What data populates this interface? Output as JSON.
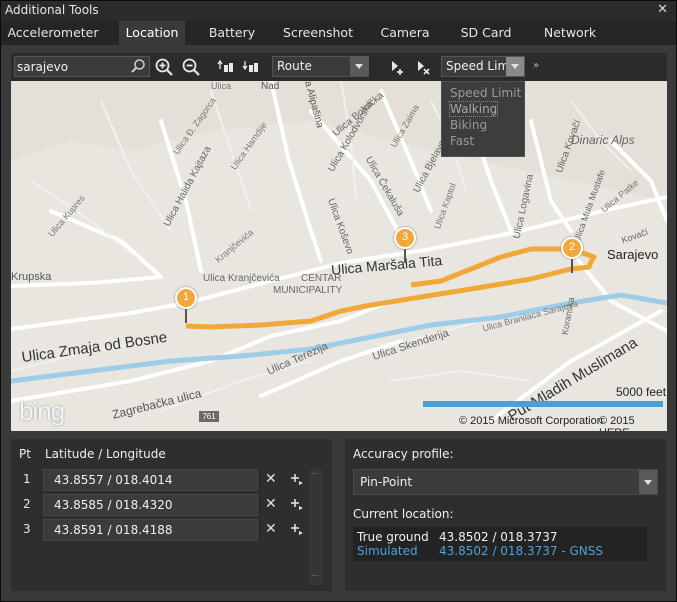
{
  "window": {
    "title": "Additional Tools",
    "close_glyph": "✕"
  },
  "tabs": [
    {
      "label": "Accelerometer"
    },
    {
      "label": "Location",
      "active": true
    },
    {
      "label": "Battery"
    },
    {
      "label": "Screenshot"
    },
    {
      "label": "Camera"
    },
    {
      "label": "SD Card"
    },
    {
      "label": "Network"
    }
  ],
  "toolbar": {
    "search_value": "sarajevo",
    "search_icon": "search-icon",
    "zoom_in_icon": "zoom-in-icon",
    "zoom_out_icon": "zoom-out-icon",
    "mode_dropdown": {
      "value": "Route"
    },
    "speed_dropdown": {
      "value": "Speed Limit",
      "options": [
        "Speed Limit",
        "Walking",
        "Biking",
        "Fast"
      ],
      "hovered": "Walking"
    },
    "expand_glyph": "»"
  },
  "map": {
    "labels": [
      "Ulica Zmaja od Bosne",
      "Ulica Maršala Tita",
      "Put Mladih Muslimana",
      "Sarajevo",
      "Dinaric Alps",
      "CENTAR",
      "MUNICIPALITY",
      "Ulica Terezija",
      "Ulica Skenderija",
      "Zagrebačka ulica",
      "Krupska",
      "Ulica Kranjčevića",
      "Ulica Halida Kajtaza",
      "Ulica Kolodvorska",
      "Ulica Bolnička",
      "Ulica Čekaluša",
      "Ulica Bjelave",
      "Ulica Logavina",
      "Ulica Kovačí",
      "Koranska",
      "Kovačí",
      "Ulica Koševo",
      "Ulica Mula Mustafe",
      "Kranjčevića",
      "Ulica Hamdije",
      "Ulica Đ. Zagorca",
      "Ulica Kupres",
      "Ulica Zaima",
      "Ulica Branilaca Sarajeva",
      "Ulica Patke",
      "Ulica Kaptol",
      "Ulica Alipašina",
      "Nad",
      "Ulica"
    ],
    "pins": [
      "1",
      "2",
      "3"
    ],
    "scale_text": "5000 feet",
    "copyright_ms": "© 2015 Microsoft Corporation",
    "copyright_here": "© 2015 HERE",
    "logo_text": "bing",
    "road_badge": "761"
  },
  "points": {
    "header_pt": "Pt",
    "header_latlon": "Latitude / Longitude",
    "rows": [
      {
        "index": "1",
        "coord": "43.8557 / 018.4014"
      },
      {
        "index": "2",
        "coord": "43.8585 / 018.4320"
      },
      {
        "index": "3",
        "coord": "43.8591 / 018.4188"
      }
    ],
    "remove_glyph": "✕",
    "scroll_dots": "..."
  },
  "accuracy": {
    "label": "Accuracy profile:",
    "value": "Pin-Point",
    "current_label": "Current location:",
    "true_ground_label": "True ground",
    "true_ground_value": "43.8502 /  018.3737",
    "simulated_label": "Simulated",
    "simulated_value": "43.8502 /  018.3737 - GNSS"
  },
  "colors": {
    "route": "#f0a838",
    "river": "#9fcde8",
    "simulated": "#4aa3df",
    "scalebar": "#4a9fd8"
  }
}
